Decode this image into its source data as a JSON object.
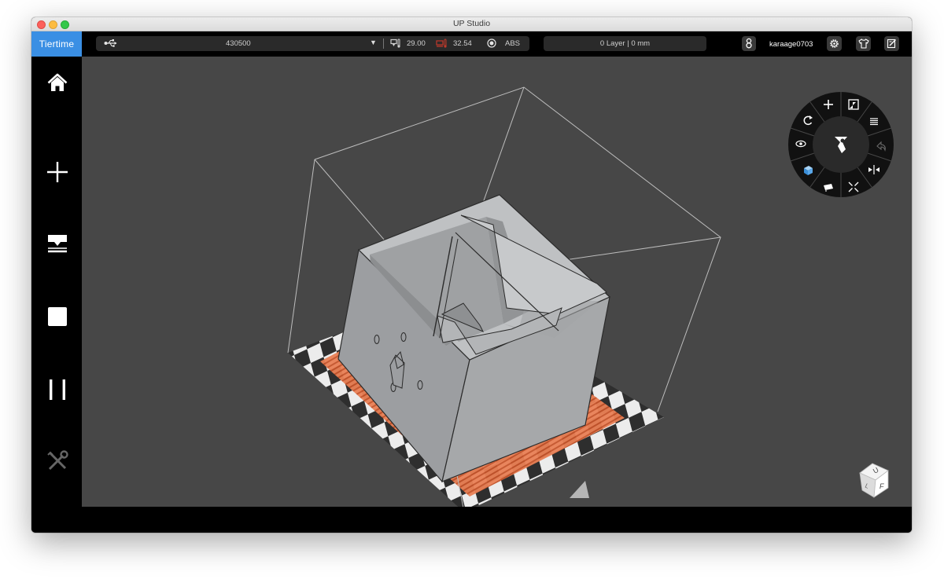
{
  "window": {
    "title": "UP Studio"
  },
  "brand": {
    "label": "Tiertime"
  },
  "printer": {
    "name": "430500",
    "dropdown_symbol": "▼",
    "nozzle_temp": "29.00",
    "bed_temp": "32.54",
    "material": "ABS"
  },
  "layer_status": "0 Layer | 0 mm",
  "user": {
    "name": "karaage0703"
  },
  "sidebar": {
    "items": [
      {
        "name": "home",
        "icon": "home-icon"
      },
      {
        "name": "add",
        "icon": "plus-icon"
      },
      {
        "name": "print",
        "icon": "print-icon"
      },
      {
        "name": "stop",
        "icon": "stop-icon"
      },
      {
        "name": "pause",
        "icon": "pause-icon"
      },
      {
        "name": "maintenance",
        "icon": "tools-icon",
        "disabled": true
      }
    ]
  },
  "radial_menu": {
    "center_icon": "auto-place-icon",
    "items": [
      "move-icon",
      "scale-icon",
      "layers-icon",
      "undo-icon",
      "mirror-icon",
      "collapse-icon",
      "support-icon",
      "cube-icon",
      "view-icon",
      "rotate-icon"
    ]
  },
  "view_cube": {
    "faces": [
      "U",
      "F",
      "L"
    ]
  },
  "colors": {
    "brand": "#3a8fe4",
    "accent_nozzle": "#c0392b",
    "raft": "#e8734a",
    "viewport": "#474747",
    "model": "#9a9c9e"
  }
}
